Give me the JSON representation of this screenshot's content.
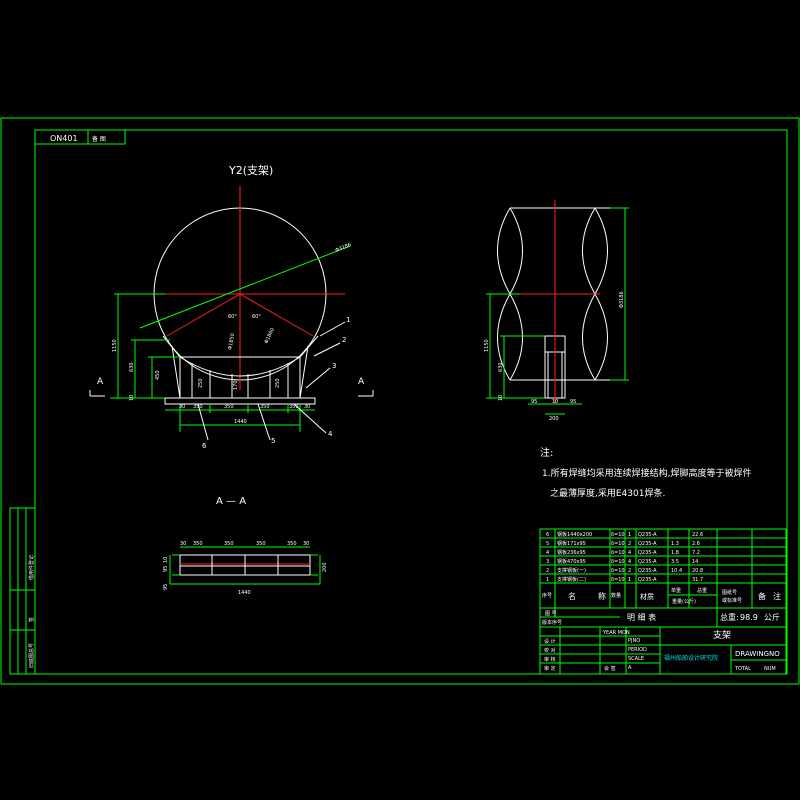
{
  "frame": {
    "drawing_code": "ON401",
    "tag": "备 图"
  },
  "main_view": {
    "title": "Y2(支架)",
    "dims": {
      "dia": "Φ3186",
      "h_total": "1150",
      "h_left": "630",
      "h_inner": "450",
      "h_base": "10",
      "h_a": "250",
      "h_b": "170",
      "h_c": "250",
      "ang_l": "60°",
      "ang_r": "60°",
      "r_inner": "Φ1850",
      "r_inner2": "Φ1860",
      "w_total": "1440",
      "w_segs": [
        "30",
        "350",
        "350",
        "350",
        "350",
        "30"
      ]
    },
    "callouts": [
      "1",
      "2",
      "3",
      "4",
      "5",
      "6"
    ],
    "section_marks": [
      "A",
      "A"
    ]
  },
  "side_view": {
    "dims": {
      "dia": "Φ3186",
      "h_total": "1150",
      "h_left": "630",
      "h_base": "10",
      "w_a": "95",
      "w_b": "10",
      "w_c": "95",
      "w_total": "200"
    }
  },
  "section_view": {
    "title": "A — A",
    "dims": {
      "w_segs": [
        "30",
        "350",
        "350",
        "350",
        "350",
        "30"
      ],
      "w_total": "1440",
      "h_a": "95",
      "h_b": "10",
      "h_c": "95",
      "h_r": "200"
    }
  },
  "notes": {
    "heading": "注:",
    "line1": "1.所有焊缝均采用连续焊接结构,焊脚高度等于被焊件",
    "line2": "之最薄厚度,采用E4301焊条."
  },
  "bom": {
    "rows": [
      {
        "no": "6",
        "name": "钢板1440x200",
        "spec": "δ=10",
        "qty": "1",
        "mat": "Q235-A",
        "unit": "",
        "total": "22.6"
      },
      {
        "no": "5",
        "name": "钢板171x95",
        "spec": "δ=10",
        "qty": "2",
        "mat": "Q235-A",
        "unit": "1.3",
        "total": "2.6"
      },
      {
        "no": "4",
        "name": "钢板236x95",
        "spec": "δ=10",
        "qty": "4",
        "mat": "Q235-A",
        "unit": "1.8",
        "total": "7.2"
      },
      {
        "no": "3",
        "name": "钢板470x95",
        "spec": "δ=10",
        "qty": "4",
        "mat": "Q235-A",
        "unit": "3.5",
        "total": "14"
      },
      {
        "no": "2",
        "name": "支撑钢板(一)",
        "spec": "δ=10",
        "qty": "2",
        "mat": "Q235-A",
        "unit": "10.4",
        "total": "20.8"
      },
      {
        "no": "1",
        "name": "支撑钢板(二)",
        "spec": "δ=10",
        "qty": "1",
        "mat": "Q235-A",
        "unit": "",
        "total": "31.7"
      }
    ],
    "header": {
      "no": "序号",
      "name": "名",
      "name2": "称",
      "qty": "数量",
      "mat": "材质",
      "unit": "单重",
      "total": "总重",
      "weight_unit": "重量(公斤)",
      "drawing": "图纸号",
      "drawing2": "或标准号",
      "remark": "备",
      "remark2": "注"
    },
    "summary": {
      "label": "明 细 表",
      "total_label": "总重:",
      "total_value": "98.9",
      "total_unit": "公斤",
      "left1": "图 号",
      "left2": "版本序号"
    }
  },
  "title_block": {
    "ym_label": "YEAR MON",
    "part_name": "支架",
    "project": "PJNO",
    "period": "PERIOD",
    "scale": "SCALE",
    "company": "福州船舶设计研究院",
    "drawing_no": "DRAWINGNO",
    "total": "TOTAL",
    "num": "NUM",
    "rev": "A",
    "role1": "设 计",
    "role2": "校 对",
    "role3": "审 核",
    "role4": "审 定",
    "role5": "会 签"
  },
  "side_strip": {
    "label1": "借用件登记",
    "label2": "签",
    "label3": "旧底图总号"
  }
}
